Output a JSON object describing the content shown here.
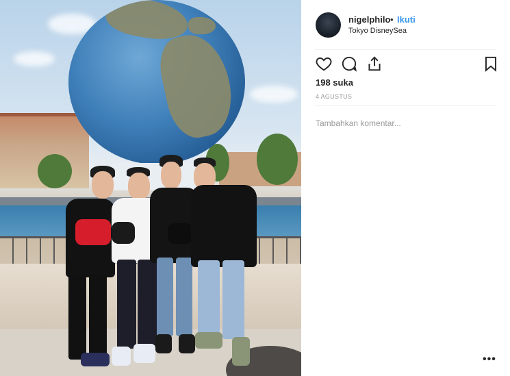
{
  "post": {
    "username": "nigelphilo",
    "separator": "•",
    "follow_label": "Ikuti",
    "location": "Tokyo DisneySea",
    "likes": "198 suka",
    "date": "4 AGUSTUS",
    "comment_placeholder": "Tambahkan komentar...",
    "more_label": "•••"
  },
  "icons": {
    "like": "heart-icon",
    "comment": "comment-icon",
    "share": "share-icon",
    "save": "bookmark-icon",
    "more": "more-options-icon"
  },
  "colors": {
    "accent": "#3897f0",
    "text": "#262626",
    "muted": "#999999",
    "divider": "#efefef"
  }
}
